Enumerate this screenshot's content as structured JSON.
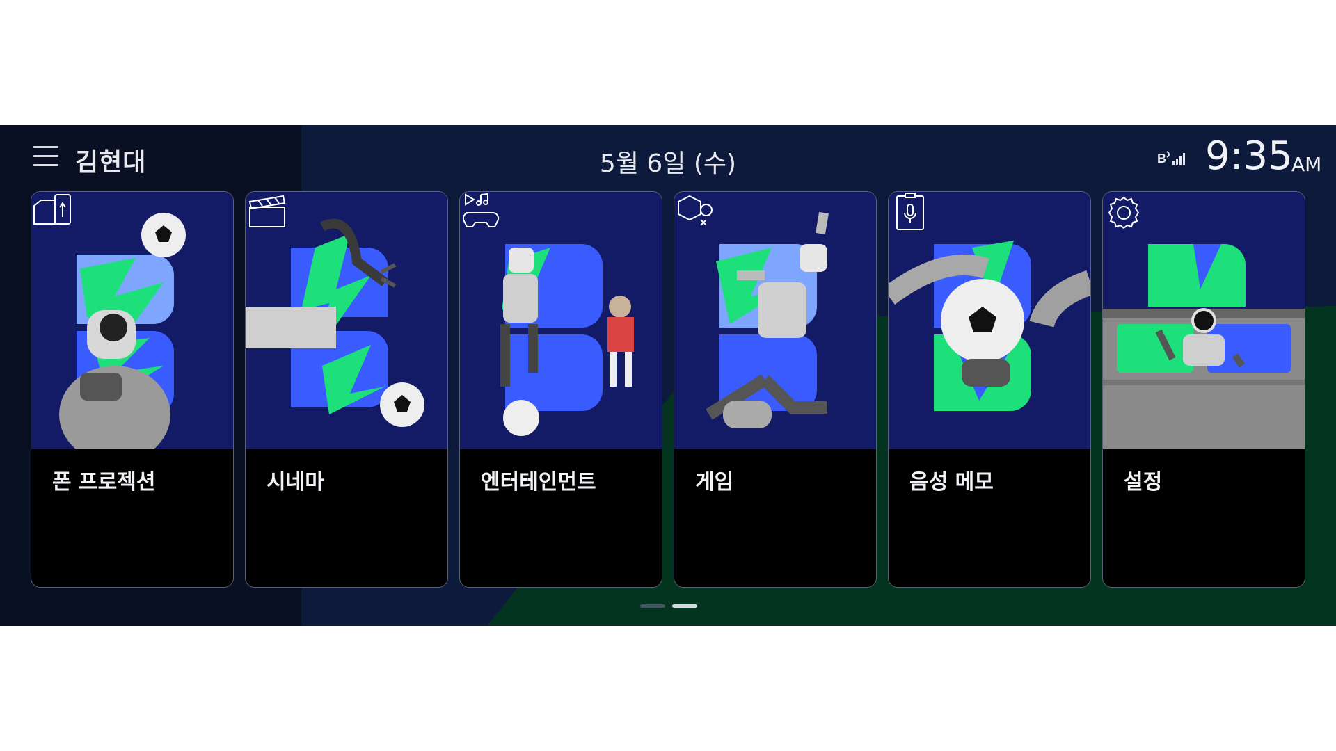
{
  "header": {
    "user_name": "김현대",
    "date": "5월 6일 (수)",
    "time": "9:35",
    "ampm": "AM"
  },
  "cards": [
    {
      "label": "폰 프로젝션",
      "icon": "phone-projection-icon"
    },
    {
      "label": "시네마",
      "icon": "clapperboard-icon"
    },
    {
      "label": "엔터테인먼트",
      "icon": "media-gamepad-icon"
    },
    {
      "label": "게임",
      "icon": "game-shapes-icon"
    },
    {
      "label": "음성 메모",
      "icon": "voice-memo-icon"
    },
    {
      "label": "설정",
      "icon": "gear-icon"
    }
  ],
  "pager": {
    "pages": 2,
    "current": 2
  },
  "colors": {
    "card_art_bg": "#131a66",
    "green_accent": "#1ee07a",
    "blue_accent": "#3a5cff",
    "light_blue": "#7fa6ff",
    "screen_bg": "#0e1a3c",
    "green_bg": "#03341f"
  }
}
